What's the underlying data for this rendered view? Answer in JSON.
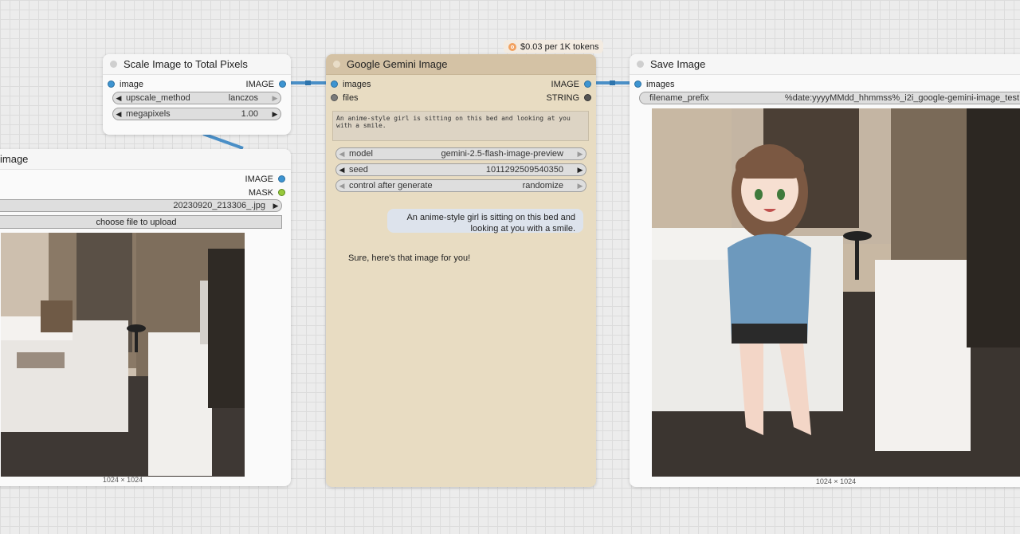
{
  "scale_node": {
    "title": "Scale Image to Total Pixels",
    "input_image": "image",
    "output_image": "IMAGE",
    "upscale_method": {
      "label": "upscale_method",
      "value": "lanczos"
    },
    "megapixels": {
      "label": "megapixels",
      "value": "1.00"
    }
  },
  "load_node": {
    "title": "image",
    "output_image": "IMAGE",
    "output_mask": "MASK",
    "file": "20230920_213306_.jpg",
    "upload_button": "choose file to upload",
    "size": "1024 × 1024"
  },
  "gemini_node": {
    "title": "Google Gemini Image",
    "price_badge": "$0.03 per 1K tokens",
    "input_images": "images",
    "input_files": "files",
    "output_image": "IMAGE",
    "output_string": "STRING",
    "prompt": "An anime-style girl is sitting on this bed and looking at you with a smile.",
    "model": {
      "label": "model",
      "value": "gemini-2.5-flash-image-preview"
    },
    "seed": {
      "label": "seed",
      "value": "1011292509540350"
    },
    "control": {
      "label": "control after generate",
      "value": "randomize"
    },
    "user_message": "An anime-style girl is sitting on this bed and looking at you with a smile.",
    "assistant_message": "Sure, here's that image for you!"
  },
  "save_node": {
    "title": "Save Image",
    "input_images": "images",
    "filename_prefix": {
      "label": "filename_prefix",
      "value": "%date:yyyyMMdd_hhmmss%_i2i_google-gemini-image_test"
    },
    "size": "1024 × 1024"
  },
  "colors": {
    "link_image": "#4a8fc7",
    "gemini_body": "#e8dcc2",
    "gemini_header": "#d4c2a5"
  }
}
